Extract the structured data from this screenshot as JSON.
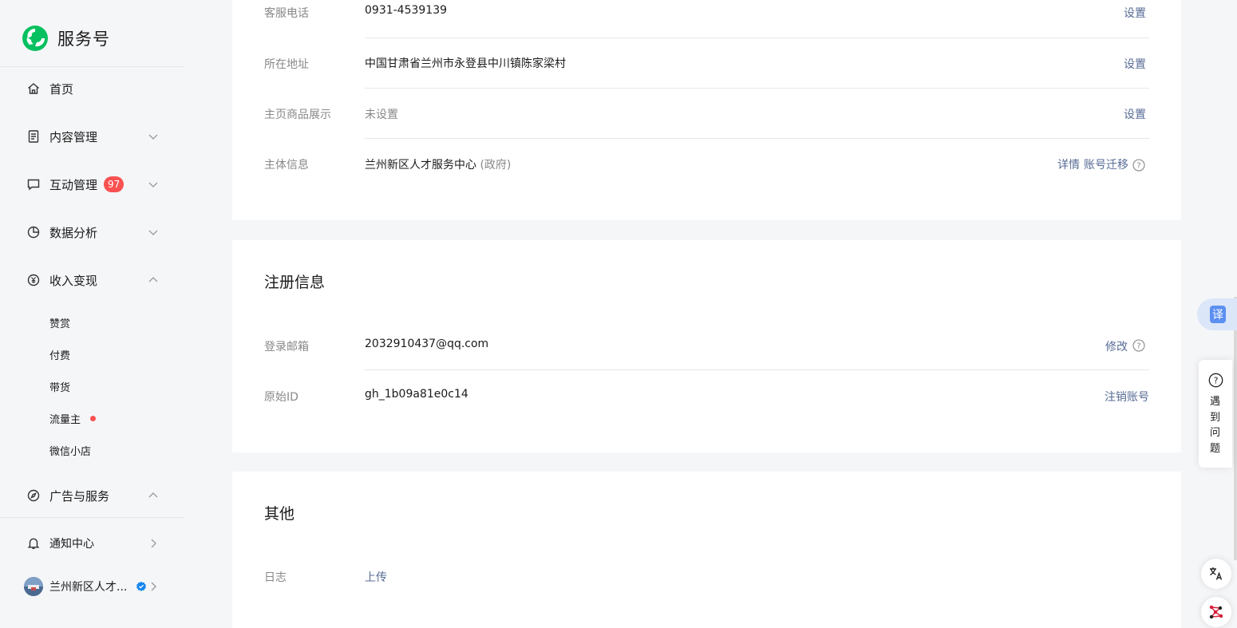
{
  "brand": {
    "name": "服务号"
  },
  "sidebar": {
    "items": [
      {
        "key": "home",
        "label": "首页",
        "icon": "home-icon"
      },
      {
        "key": "content",
        "label": "内容管理",
        "icon": "document-icon",
        "chevron": "down"
      },
      {
        "key": "interaction",
        "label": "互动管理",
        "icon": "chat-icon",
        "chevron": "down",
        "badge": "97"
      },
      {
        "key": "data",
        "label": "数据分析",
        "icon": "pie-chart-icon",
        "chevron": "down"
      },
      {
        "key": "income",
        "label": "收入变现",
        "icon": "yen-coin-icon",
        "chevron": "up"
      },
      {
        "key": "ads",
        "label": "广告与服务",
        "icon": "compass-icon",
        "chevron": "up"
      },
      {
        "key": "notify",
        "label": "通知中心",
        "icon": "bell-icon",
        "chevron": "right"
      }
    ],
    "income_sub": [
      {
        "label": "赞赏"
      },
      {
        "label": "付费"
      },
      {
        "label": "带货"
      },
      {
        "label": "流量主",
        "dot": true
      },
      {
        "label": "微信小店"
      }
    ],
    "account": {
      "name": "兰州新区人才..."
    }
  },
  "basic": {
    "rows": [
      {
        "label": "客服电话",
        "value": "0931-4539139",
        "action": "设置"
      },
      {
        "label": "所在地址",
        "value": "中国甘肃省兰州市永登县中川镇陈家梁村",
        "action": "设置"
      },
      {
        "label": "主页商品展示",
        "value": "未设置",
        "action": "设置"
      },
      {
        "label": "主体信息",
        "value": "兰州新区人才服务中心",
        "value_suffix": "(政府)",
        "action_detail": "详情",
        "action_migrate": "账号迁移"
      }
    ]
  },
  "registration": {
    "title": "注册信息",
    "rows": [
      {
        "label": "登录邮箱",
        "value": "2032910437@qq.com",
        "action": "修改"
      },
      {
        "label": "原始ID",
        "value": "gh_1b09a81e0c14",
        "action": "注销账号"
      }
    ]
  },
  "other": {
    "title": "其他",
    "rows": [
      {
        "label": "日志",
        "value": "上传"
      }
    ]
  },
  "widgets": {
    "translate_label": "译",
    "help_text": "遇到问题"
  },
  "colors": {
    "link": "#576b95",
    "badge": "#fa5151",
    "brand_green": "#07c160",
    "muted": "#888888"
  }
}
